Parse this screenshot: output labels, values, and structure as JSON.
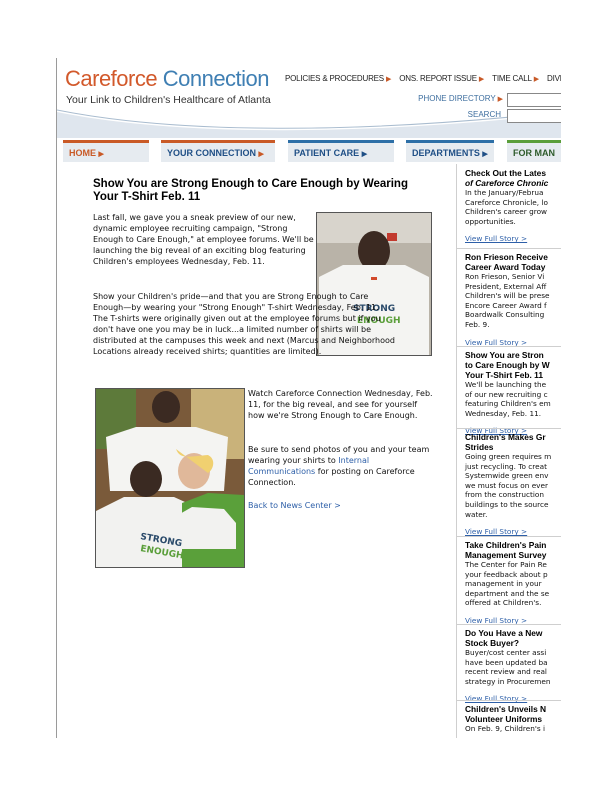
{
  "header": {
    "logo_care": "Careforce",
    "logo_conn": "Connection",
    "tagline": "Your Link to Children's Healthcare of Atlanta",
    "top_nav": [
      "POLICIES & PROCEDURES",
      "ONS. REPORT ISSUE",
      "TIME CALL",
      "DIVERSIO"
    ],
    "phone_directory_label": "PHONE DIRECTORY",
    "search_label": "SEARCH"
  },
  "tabs": [
    "HOME",
    "YOUR CONNECTION",
    "PATIENT CARE",
    "DEPARTMENTS",
    "FOR MAN"
  ],
  "article": {
    "headline": "Show You are Strong Enough to Care Enough by Wearing Your T-Shirt Feb. 11",
    "p1": "Last fall, we gave you a sneak preview of our new, dynamic employee recruiting campaign, \"Strong Enough to Care Enough,\" at employee forums. We'll be launching the big reveal of an exciting blog featuring Children's employees Wednesday, Feb. 11.",
    "p2": "Show your Children's pride—and that you are Strong Enough to Care Enough—by wearing your \"Strong Enough\" T-shirt Wednesday, Feb. 11. The T-shirts were originally given out at the employee forums but if you don't have one you may be in luck...a limited number of shirts will be distributed at the campuses this week and next (Marcus and Neighborhood Locations already received shirts; quantities are limited).",
    "p3": "Watch Careforce Connection Wednesday, Feb. 11, for the big reveal, and see for yourself how we're Strong Enough to Care Enough.",
    "p4_a": "Be sure to send photos of you and your team wearing your shirts to",
    "p4_link": "Internal Communications",
    "p4_b": "for posting on Careforce Connection.",
    "back_link": "Back to News Center >",
    "shirt_text_1": "STRONG",
    "shirt_text_2": "ENOUGH"
  },
  "sidebar": [
    {
      "title": "Check Out the Lates",
      "title2": "of Careforce Chronic",
      "body": "In the January/Februa\nCareforce Chronicle, lo\nChildren's career grow\nopportunities.",
      "link": "View Full Story >"
    },
    {
      "title": "Ron Frieson Receive\nCareer Award Today",
      "body": "Ron Frieson, Senior Vi\nPresident, External Aff\nChildren's will be prese\nEncore Career Award f\nBoardwalk Consulting\nFeb. 9.",
      "link": "View Full Story >"
    },
    {
      "title": "Show You are Stron\nto Care Enough by W\nYour T-Shirt Feb. 11",
      "body": "We'll be launching the\nof our new recruiting c\nfeaturing Children's em\nWednesday, Feb. 11.",
      "link": "View Full Story >"
    },
    {
      "title": "Children's Makes Gr\nStrides",
      "body": "Going green requires m\njust recycling. To creat\nSystemwide green env\nwe must focus on ever\nfrom the construction\nbuildings to the source\nwater.",
      "link": "View Full Story >"
    },
    {
      "title": "Take Children's Pain\nManagement Survey",
      "body": "The Center for Pain Re\nyour feedback about p\nmanagement in your\ndepartment and the se\noffered at Children's.",
      "link": "View Full Story >"
    },
    {
      "title": "Do You Have a New\nStock Buyer?",
      "body": "Buyer/cost center assi\nhave been updated ba\nrecent review and real\nstrategy in Procuremen",
      "link": "View Full Story >"
    },
    {
      "title": "Children's Unveils N\nVolunteer Uniforms",
      "body": "On Feb. 9, Children's i",
      "link": ""
    }
  ]
}
